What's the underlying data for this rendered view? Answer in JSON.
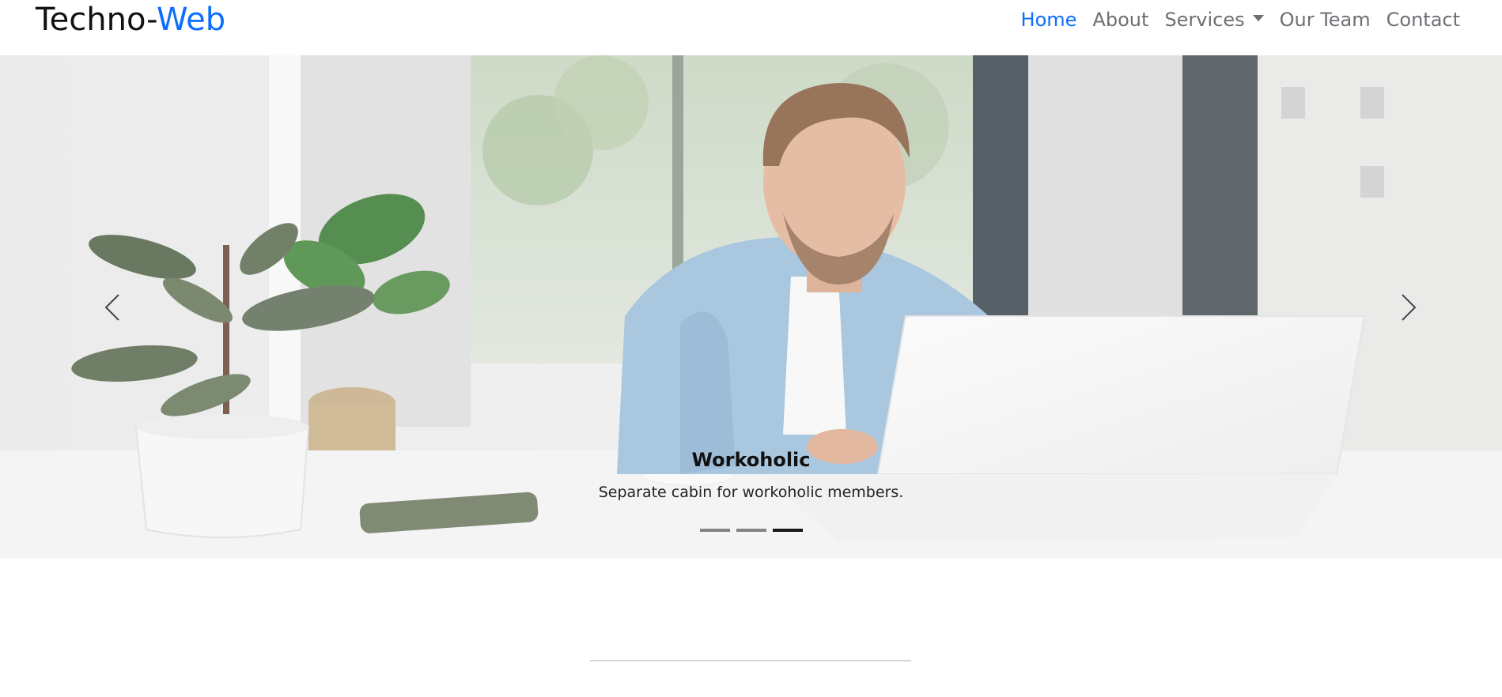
{
  "brand": {
    "part1": "Techno-",
    "part2": "Web"
  },
  "nav": {
    "home": "Home",
    "about": "About",
    "services": "Services",
    "team": "Our Team",
    "contact": "Contact"
  },
  "carousel": {
    "caption_title": "Workoholic",
    "caption_text": "Separate cabin for workoholic members.",
    "slides_total": 3,
    "active_slide": 3,
    "prev_icon": "chevron-left-icon",
    "next_icon": "chevron-right-icon"
  },
  "colors": {
    "accent": "#0d6efd",
    "nav_text": "#6c6f73"
  }
}
